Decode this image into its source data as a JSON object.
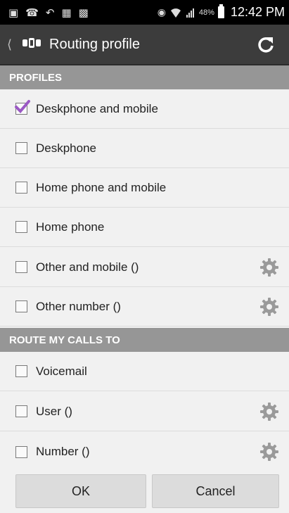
{
  "status_bar": {
    "battery_percent": "48%",
    "time": "12:42 PM"
  },
  "action_bar": {
    "title": "Routing profile"
  },
  "sections": {
    "profiles": {
      "header": "PROFILES",
      "items": [
        {
          "label": "Deskphone and mobile",
          "checked": true,
          "has_settings": false
        },
        {
          "label": "Deskphone",
          "checked": false,
          "has_settings": false
        },
        {
          "label": "Home phone and mobile",
          "checked": false,
          "has_settings": false
        },
        {
          "label": "Home phone",
          "checked": false,
          "has_settings": false
        },
        {
          "label": "Other and mobile ()",
          "checked": false,
          "has_settings": true
        },
        {
          "label": "Other number ()",
          "checked": false,
          "has_settings": true
        }
      ]
    },
    "route": {
      "header": "ROUTE MY CALLS TO",
      "items": [
        {
          "label": "Voicemail",
          "checked": false,
          "has_settings": false
        },
        {
          "label": "User ()",
          "checked": false,
          "has_settings": true
        },
        {
          "label": "Number ()",
          "checked": false,
          "has_settings": true
        }
      ]
    }
  },
  "buttons": {
    "ok": "OK",
    "cancel": "Cancel"
  },
  "colors": {
    "check_accent": "#9b59c4",
    "action_bar": "#3c3c3c",
    "section_header": "#969696"
  }
}
